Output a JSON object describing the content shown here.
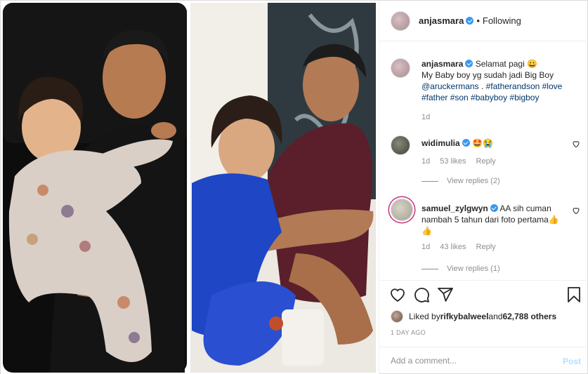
{
  "header": {
    "username": "anjasmara",
    "separator": "•",
    "follow_status": "Following"
  },
  "caption": {
    "username": "anjasmara",
    "line1": "Selamat pagi 😀",
    "line2": "My Baby boy yg sudah jadi Big Boy",
    "mention": "@aruckermans",
    "after_mention": " . ",
    "tags_line1": "#fatherandson #love",
    "tags_line2": "#father #son #babyboy #bigboy",
    "time": "1d"
  },
  "comments": [
    {
      "username": "widimulia",
      "text": "🤩😭",
      "time": "1d",
      "likes": "53 likes",
      "reply": "Reply",
      "view_replies": "View replies (2)"
    },
    {
      "username": "samuel_zylgwyn",
      "text": "AA sih cuman nambah 5 tahun dari foto pertama👍👍",
      "time": "1d",
      "likes": "43 likes",
      "reply": "Reply",
      "view_replies": "View replies (1)"
    }
  ],
  "likes": {
    "prefix": "Liked by ",
    "user": "rifkybalweel",
    "middle": " and ",
    "others": "62,788 others"
  },
  "post_time": "1 DAY AGO",
  "comment_box": {
    "placeholder": "Add a comment...",
    "post_label": "Post"
  },
  "icons": {
    "like": "heart-icon",
    "comment": "comment-icon",
    "share": "share-icon",
    "save": "bookmark-icon"
  }
}
